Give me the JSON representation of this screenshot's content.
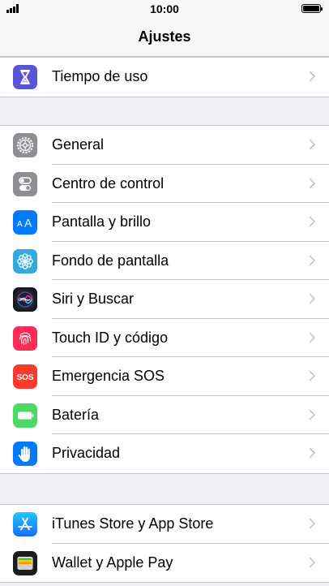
{
  "status_bar": {
    "time": "10:00"
  },
  "header": {
    "title": "Ajustes"
  },
  "groups": [
    {
      "items": [
        {
          "label": "Tiempo de uso",
          "icon": "hourglass-icon",
          "color": "#5856d6"
        }
      ]
    },
    {
      "items": [
        {
          "label": "General",
          "icon": "gear-icon",
          "color": "#8e8e93"
        },
        {
          "label": "Centro de control",
          "icon": "toggle-switches-icon",
          "color": "#8e8e93"
        },
        {
          "label": "Pantalla y brillo",
          "icon": "text-size-icon",
          "color": "#007aff"
        },
        {
          "label": "Fondo de pantalla",
          "icon": "flower-icon",
          "color": "#34aadc"
        },
        {
          "label": "Siri y Buscar",
          "icon": "siri-icon",
          "color": "#1c1c1e"
        },
        {
          "label": "Touch ID y código",
          "icon": "fingerprint-icon",
          "color": "#ff2d55"
        },
        {
          "label": "Emergencia SOS",
          "icon": "sos-icon",
          "icon_text": "SOS",
          "color": "#ff3b30"
        },
        {
          "label": "Batería",
          "icon": "battery-icon",
          "color": "#4cd964"
        },
        {
          "label": "Privacidad",
          "icon": "hand-icon",
          "color": "#007aff"
        }
      ]
    },
    {
      "items": [
        {
          "label": "iTunes Store y App Store",
          "icon": "app-store-icon",
          "color": "#1a8cff"
        },
        {
          "label": "Wallet y Apple Pay",
          "icon": "wallet-icon",
          "color": "#1c1c1e"
        }
      ]
    }
  ]
}
